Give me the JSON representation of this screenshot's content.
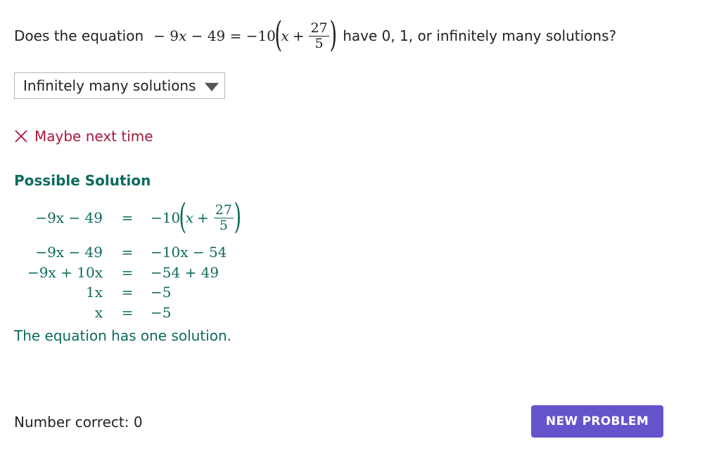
{
  "question": {
    "prefix": "Does the equation",
    "equation": {
      "lhs": "− 9x − 49",
      "lhs_coef": "9",
      "lhs_const": "49",
      "rhs_coef": "−10",
      "inner_var": "x",
      "inner_op": "+",
      "frac_num": "27",
      "frac_den": "5"
    },
    "suffix": "have 0, 1, or infinitely many solutions?"
  },
  "dropdown": {
    "selected": "Infinitely many solutions",
    "icon": "triangle-down-icon"
  },
  "feedback": {
    "icon": "x-icon",
    "text": "Maybe next time",
    "color": "#a51a3c"
  },
  "solution": {
    "title": "Possible Solution",
    "color": "#0d6b5c",
    "steps": [
      {
        "lhs": "−9x − 49",
        "eq": "=",
        "rhs": "−10(x + 27/5)"
      },
      {
        "lhs": "−9x − 49",
        "eq": "=",
        "rhs": "−10x − 54"
      },
      {
        "lhs": "−9x + 10x",
        "eq": "=",
        "rhs": "−54 + 49"
      },
      {
        "lhs": "1x",
        "eq": "=",
        "rhs": "−5"
      },
      {
        "lhs": "x",
        "eq": "=",
        "rhs": "−5"
      }
    ],
    "step1_rhs_parts": {
      "coef": "−10",
      "var": "x",
      "op": "+",
      "num": "27",
      "den": "5"
    },
    "conclusion": "The equation has one solution."
  },
  "footer": {
    "counter_label": "Number correct: 0",
    "new_problem_label": "NEW PROBLEM",
    "button_color": "#6454cc"
  }
}
